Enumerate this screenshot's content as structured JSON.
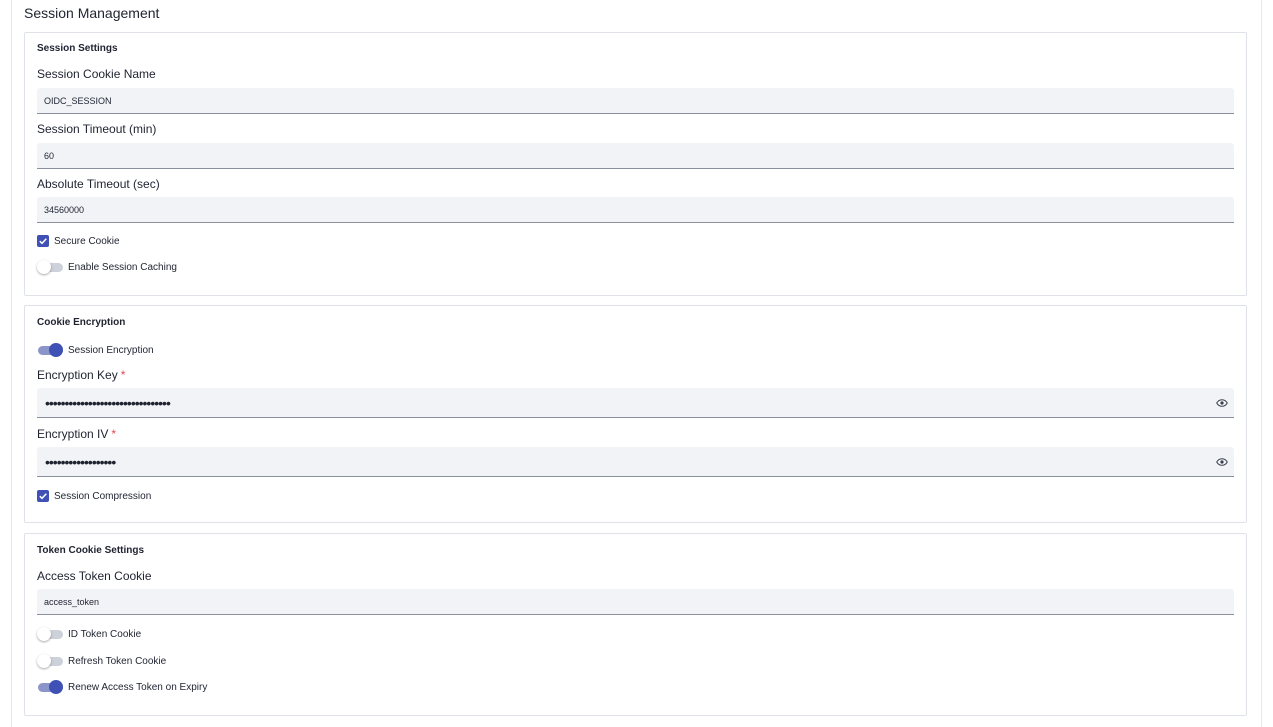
{
  "page_title": "Session Management",
  "session_settings": {
    "title": "Session Settings",
    "cookie_name_label": "Session Cookie Name",
    "cookie_name_value": "OIDC_SESSION",
    "timeout_label": "Session Timeout (min)",
    "timeout_value": "60",
    "absolute_timeout_label": "Absolute Timeout (sec)",
    "absolute_timeout_value": "34560000",
    "secure_cookie_label": "Secure Cookie",
    "secure_cookie_checked": true,
    "caching_label": "Enable Session Caching",
    "caching_enabled": false
  },
  "cookie_encryption": {
    "title": "Cookie Encryption",
    "encryption_label": "Session Encryption",
    "encryption_enabled": true,
    "key_label": "Encryption Key",
    "key_masked": "••••••••••••••••••••••••••••••••",
    "iv_label": "Encryption IV",
    "iv_masked": "••••••••••••••••••",
    "required_marker": "*",
    "compression_label": "Session Compression",
    "compression_checked": true
  },
  "token_cookie_settings": {
    "title": "Token Cookie Settings",
    "access_token_label": "Access Token Cookie",
    "access_token_value": "access_token",
    "id_token_label": "ID Token Cookie",
    "id_token_enabled": false,
    "refresh_token_label": "Refresh Token Cookie",
    "refresh_token_enabled": false,
    "renew_label": "Renew Access Token on Expiry",
    "renew_enabled": true
  },
  "colors": {
    "accent": "#3f51b5",
    "input_bg": "#f1f3f7",
    "border": "#dfe2e8"
  }
}
